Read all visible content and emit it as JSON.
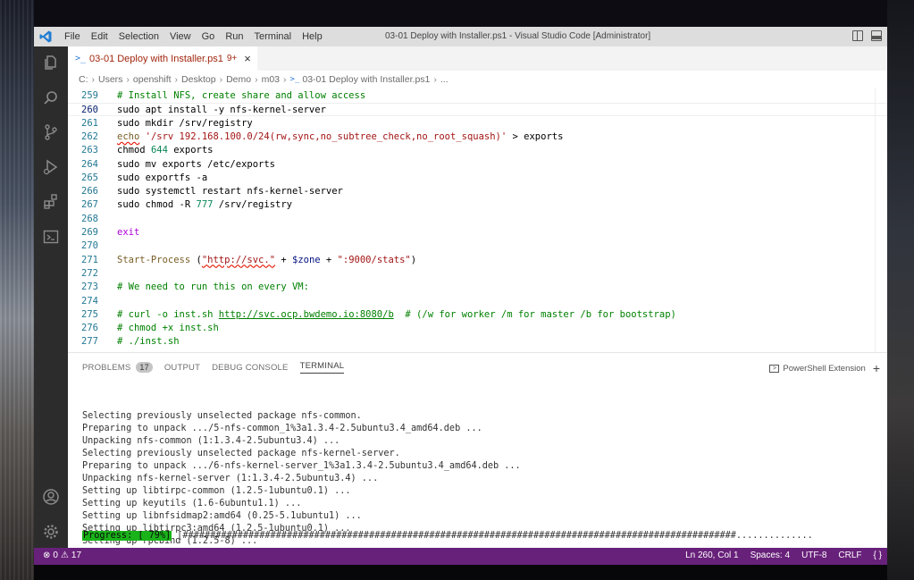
{
  "window": {
    "title": "03-01 Deploy with Installer.ps1 - Visual Studio Code [Administrator]",
    "menu": [
      "File",
      "Edit",
      "Selection",
      "View",
      "Go",
      "Run",
      "Terminal",
      "Help"
    ]
  },
  "tab": {
    "label": "03-01 Deploy with Installer.ps1",
    "badge": "9+",
    "close": "×",
    "glyph": ">_"
  },
  "breadcrumb": [
    "C:",
    "Users",
    "openshift",
    "Desktop",
    "Demo",
    "m03",
    "03-01 Deploy with Installer.ps1",
    "..."
  ],
  "editor": {
    "current_line": 260,
    "lines": [
      {
        "n": "259",
        "segs": [
          {
            "t": "# Install NFS, create share and allow access",
            "c": "t-cmt"
          }
        ]
      },
      {
        "n": "260",
        "segs": [
          {
            "t": "sudo apt install -y nfs-kernel-server",
            "c": ""
          }
        ]
      },
      {
        "n": "261",
        "segs": [
          {
            "t": "sudo mkdir /srv/registry",
            "c": ""
          }
        ]
      },
      {
        "n": "262",
        "segs": [
          {
            "t": "echo",
            "c": "t-cmd u-red"
          },
          {
            "t": " ",
            "c": ""
          },
          {
            "t": "'/srv 192.168.100.0/24(rw,sync,no_subtree_check,no_root_squash)'",
            "c": "t-str"
          },
          {
            "t": " > exports",
            "c": ""
          }
        ]
      },
      {
        "n": "263",
        "segs": [
          {
            "t": "chmod ",
            "c": ""
          },
          {
            "t": "644",
            "c": "t-num"
          },
          {
            "t": " exports",
            "c": ""
          }
        ]
      },
      {
        "n": "264",
        "segs": [
          {
            "t": "sudo mv exports /etc/exports",
            "c": ""
          }
        ]
      },
      {
        "n": "265",
        "segs": [
          {
            "t": "sudo exportfs -a",
            "c": ""
          }
        ]
      },
      {
        "n": "266",
        "segs": [
          {
            "t": "sudo systemctl restart nfs-kernel-server",
            "c": ""
          }
        ]
      },
      {
        "n": "267",
        "segs": [
          {
            "t": "sudo chmod -R ",
            "c": ""
          },
          {
            "t": "777",
            "c": "t-num"
          },
          {
            "t": " /srv/registry",
            "c": ""
          }
        ]
      },
      {
        "n": "268",
        "segs": []
      },
      {
        "n": "269",
        "segs": [
          {
            "t": "exit",
            "c": "t-kw"
          }
        ]
      },
      {
        "n": "270",
        "segs": []
      },
      {
        "n": "271",
        "segs": [
          {
            "t": "Start-Process",
            "c": "t-cmd"
          },
          {
            "t": " (",
            "c": ""
          },
          {
            "t": "\"http://svc.\"",
            "c": "t-str u-red"
          },
          {
            "t": " + ",
            "c": ""
          },
          {
            "t": "$zone",
            "c": "t-var"
          },
          {
            "t": " + ",
            "c": ""
          },
          {
            "t": "\":9000/stats\"",
            "c": "t-str"
          },
          {
            "t": ")",
            "c": ""
          }
        ]
      },
      {
        "n": "272",
        "segs": []
      },
      {
        "n": "273",
        "segs": [
          {
            "t": "# We need to run this on every VM:",
            "c": "t-cmt"
          }
        ]
      },
      {
        "n": "274",
        "segs": []
      },
      {
        "n": "275",
        "segs": [
          {
            "t": "# curl -o inst.sh ",
            "c": "t-cmt"
          },
          {
            "t": "http://svc.ocp.bwdemo.io:8080/b",
            "c": "t-cmt u-link"
          },
          {
            "t": "  # (/w for worker /m for master /b for bootstrap)",
            "c": "t-cmt"
          }
        ]
      },
      {
        "n": "276",
        "segs": [
          {
            "t": "# chmod +x inst.sh",
            "c": "t-cmt"
          }
        ]
      },
      {
        "n": "277",
        "segs": [
          {
            "t": "# ./inst.sh",
            "c": "t-cmt"
          }
        ]
      }
    ]
  },
  "panel": {
    "tabs": [
      {
        "label": "PROBLEMS",
        "badge": "17",
        "active": false
      },
      {
        "label": "OUTPUT",
        "active": false
      },
      {
        "label": "DEBUG CONSOLE",
        "active": false
      },
      {
        "label": "TERMINAL",
        "active": true
      }
    ],
    "terminal_selector": "PowerShell Extension",
    "add_terminal": "+",
    "terminal_lines": [
      "Selecting previously unselected package nfs-common.",
      "Preparing to unpack .../5-nfs-common_1%3a1.3.4-2.5ubuntu3.4_amd64.deb ...",
      "Unpacking nfs-common (1:1.3.4-2.5ubuntu3.4) ...",
      "Selecting previously unselected package nfs-kernel-server.",
      "Preparing to unpack .../6-nfs-kernel-server_1%3a1.3.4-2.5ubuntu3.4_amd64.deb ...",
      "Unpacking nfs-kernel-server (1:1.3.4-2.5ubuntu3.4) ...",
      "Setting up libtirpc-common (1.2.5-1ubuntu0.1) ...",
      "Setting up keyutils (1.6-6ubuntu1.1) ...",
      "Setting up libnfsidmap2:amd64 (0.25-5.1ubuntu1) ...",
      "Setting up libtirpc3:amd64 (1.2.5-1ubuntu0.1) ...",
      "Setting up rpcbind (1.2.5-8) ..."
    ],
    "progress_label": "Progress: [ 79%]",
    "progress_bar": " [#####################################################################################################..............",
    "progress_value": 0.79
  },
  "status": {
    "errors": "0",
    "warnings": "17",
    "position": "Ln 260, Col 1",
    "spaces": "Spaces: 4",
    "encoding": "UTF-8",
    "eol": "CRLF",
    "language": "{ }"
  },
  "colors": {
    "statusbar": "#68217a",
    "activitybar": "#2c2c2c",
    "progress": "#19b219",
    "comment": "#008000",
    "string": "#a31515"
  }
}
